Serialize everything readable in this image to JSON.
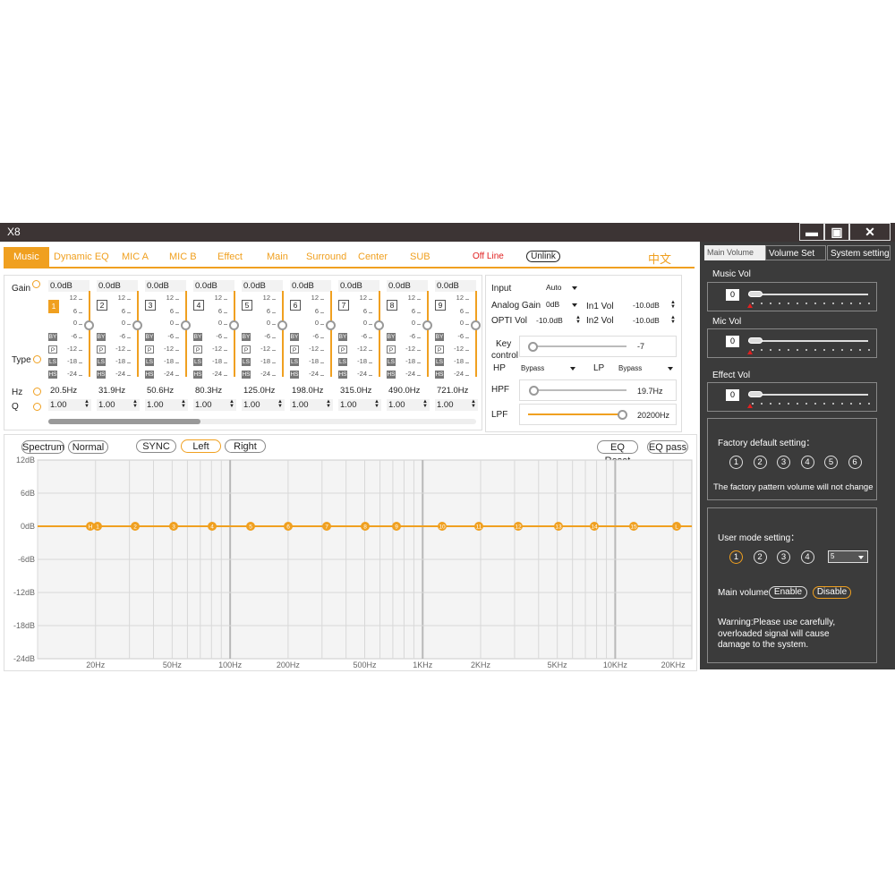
{
  "window": {
    "title": "X8"
  },
  "tabs": [
    {
      "label": "Music",
      "active": true
    },
    {
      "label": "Dynamic EQ"
    },
    {
      "label": "MIC A"
    },
    {
      "label": "MIC B"
    },
    {
      "label": "Effect"
    },
    {
      "label": "Main"
    },
    {
      "label": "Surround"
    },
    {
      "label": "Center"
    },
    {
      "label": "SUB"
    }
  ],
  "status": {
    "offline": "Off Line",
    "unlink": "Unlink",
    "language": "中文"
  },
  "eq": {
    "row_labels": {
      "gain": "Gain",
      "type": "Type",
      "hz": "Hz",
      "q": "Q"
    },
    "ticks": [
      "12",
      "6",
      "0",
      "-6",
      "-12",
      "-18",
      "-24"
    ],
    "type_buttons": [
      "BY",
      "P",
      "LS",
      "HS"
    ],
    "bands": [
      {
        "num": "1",
        "gain": "0.0dB",
        "freq": "20.5Hz",
        "q": "1.00",
        "selected": true
      },
      {
        "num": "2",
        "gain": "0.0dB",
        "freq": "31.9Hz",
        "q": "1.00"
      },
      {
        "num": "3",
        "gain": "0.0dB",
        "freq": "50.6Hz",
        "q": "1.00"
      },
      {
        "num": "4",
        "gain": "0.0dB",
        "freq": "80.3Hz",
        "q": "1.00"
      },
      {
        "num": "5",
        "gain": "0.0dB",
        "freq": "125.0Hz",
        "q": "1.00"
      },
      {
        "num": "6",
        "gain": "0.0dB",
        "freq": "198.0Hz",
        "q": "1.00"
      },
      {
        "num": "7",
        "gain": "0.0dB",
        "freq": "315.0Hz",
        "q": "1.00"
      },
      {
        "num": "8",
        "gain": "0.0dB",
        "freq": "490.0Hz",
        "q": "1.00"
      },
      {
        "num": "9",
        "gain": "0.0dB",
        "freq": "721.0Hz",
        "q": "1.00"
      }
    ]
  },
  "input_panel": {
    "input_label": "Input",
    "input_value": "Auto",
    "analog_gain_label": "Analog Gain",
    "analog_gain_value": "0dB",
    "in1_label": "In1 Vol",
    "in1_value": "-10.0dB",
    "opti_label": "OPTI Vol",
    "opti_value": "-10.0dB",
    "in2_label": "In2 Vol",
    "in2_value": "-10.0dB",
    "key_label_1": "Key",
    "key_label_2": "control",
    "key_value": "-7",
    "hp_label": "HP",
    "hp_value": "Bypass",
    "lp_label": "LP",
    "lp_value": "Bypass",
    "hpf_label": "HPF",
    "hpf_value": "19.7Hz",
    "lpf_label": "LPF",
    "lpf_value": "20200Hz"
  },
  "graph": {
    "buttons": {
      "spectrum": "Spectrum",
      "normal": "Normal",
      "sync": "SYNC",
      "left": "Left",
      "right": "Right",
      "eq_reset": "EQ Reset",
      "eq_pass": "EQ pass"
    },
    "y_labels": [
      "12dB",
      "6dB",
      "0dB",
      "-6dB",
      "-12dB",
      "-18dB",
      "-24dB"
    ],
    "x_labels": [
      "20Hz",
      "50Hz",
      "100Hz",
      "200Hz",
      "500Hz",
      "1KHz",
      "2KHz",
      "5KHz",
      "10KHz",
      "20KHz"
    ],
    "nodes": [
      "H",
      "1",
      "2",
      "3",
      "4",
      "5",
      "6",
      "7",
      "8",
      "9",
      "10",
      "11",
      "12",
      "13",
      "14",
      "15",
      "L"
    ],
    "colors": {
      "accent": "#f0a020",
      "grid": "#d8d8d8"
    }
  },
  "right_panel": {
    "tabs": [
      "Main Volume",
      "Volume Set",
      "System setting"
    ],
    "music_vol": {
      "label": "Music Vol",
      "value": "0"
    },
    "mic_vol": {
      "label": "Mic Vol",
      "value": "0"
    },
    "effect_vol": {
      "label": "Effect Vol",
      "value": "0"
    },
    "factory": {
      "title": "Factory default setting：",
      "presets": [
        "1",
        "2",
        "3",
        "4",
        "5",
        "6"
      ],
      "note": "The factory pattern volume will not change"
    },
    "user_mode": {
      "title": "User mode setting：",
      "presets": [
        "1",
        "2",
        "3",
        "4"
      ],
      "select_value": "5"
    },
    "main_volume": {
      "label": "Main volume",
      "enable": "Enable",
      "disable": "Disable"
    },
    "warning": "Warning:Please use carefully, overloaded signal will cause damage to the system."
  }
}
